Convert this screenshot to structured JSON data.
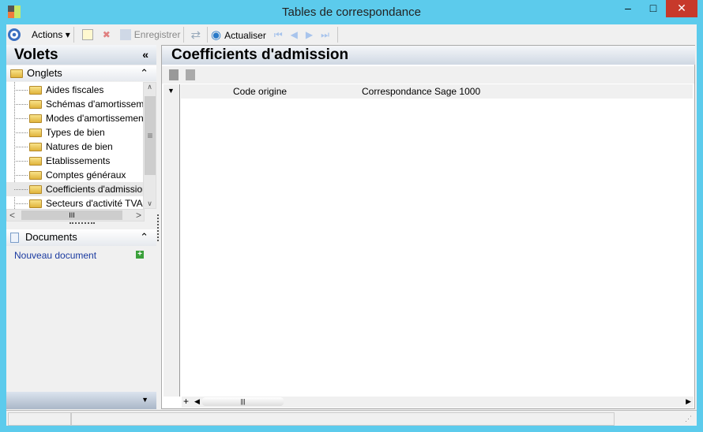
{
  "window": {
    "title": "Tables de correspondance",
    "minimize": "‒",
    "maximize": "□",
    "close": "✕"
  },
  "toolbar": {
    "actions": "Actions",
    "save": "Enregistrer",
    "refresh": "Actualiser"
  },
  "left": {
    "title": "Volets",
    "collapse": "«",
    "tabs_section": "Onglets",
    "tabs": [
      "Aides fiscales",
      "Schémas d'amortissement",
      "Modes d'amortissement",
      "Types de bien",
      "Natures de bien",
      "Etablissements",
      "Comptes généraux",
      "Coefficients d'admission",
      "Secteurs d'activité TVA"
    ],
    "selected_tab": "Coefficients d'admission",
    "documents_section": "Documents",
    "new_document": "Nouveau document"
  },
  "main": {
    "title": "Coefficients d'admission",
    "columns": [
      "Code origine",
      "Correspondance Sage 1000"
    ]
  },
  "colors": {
    "window_border": "#5ccbec",
    "close_button": "#c7392b"
  }
}
